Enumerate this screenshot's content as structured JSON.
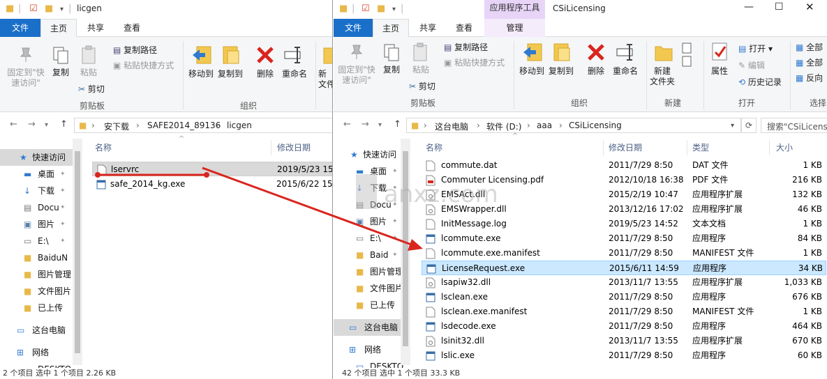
{
  "left": {
    "title": "licgen",
    "tabs": [
      "文件",
      "主页",
      "共享",
      "查看"
    ],
    "ribbon": {
      "pin_label_1": "固定到\"快",
      "pin_label_2": "速访问\"",
      "copy": "复制",
      "paste": "粘贴",
      "copy_path": "复制路径",
      "paste_shortcut": "粘贴快捷方式",
      "cut": "剪切",
      "group_clipboard": "剪贴板",
      "move_to": "移动到",
      "copy_to": "复制到",
      "delete": "删除",
      "rename": "重命名",
      "new_partial_1": "新",
      "new_partial_2": "文件",
      "group_organize": "组织"
    },
    "breadcrumb": [
      "安下载",
      "SAFE2014_89136",
      "licgen"
    ],
    "columns": {
      "name": "名称",
      "date": "修改日期"
    },
    "nav": [
      {
        "label": "快速访问"
      },
      {
        "label": "桌面"
      },
      {
        "label": "下载"
      },
      {
        "label": "Docu"
      },
      {
        "label": "图片"
      },
      {
        "label": "E:\\"
      },
      {
        "label": "BaiduN"
      },
      {
        "label": "图片管理"
      },
      {
        "label": "文件图片"
      },
      {
        "label": "已上传"
      },
      {
        "label": "这台电脑"
      },
      {
        "label": "网络"
      },
      {
        "label": "DESKTO"
      }
    ],
    "files": [
      {
        "name": "lservrc",
        "date": "2019/5/23 15"
      },
      {
        "name": "safe_2014_kg.exe",
        "date": "2015/6/22 15"
      }
    ],
    "status": "2 个项目    选中 1 个项目  2.26 KB"
  },
  "right": {
    "title": "CSiLicensing",
    "context_tab_header": "应用程序工具",
    "tabs": [
      "文件",
      "主页",
      "共享",
      "查看",
      "管理"
    ],
    "ribbon": {
      "pin_label_1": "固定到\"快",
      "pin_label_2": "速访问\"",
      "copy": "复制",
      "paste": "粘贴",
      "copy_path": "复制路径",
      "paste_shortcut": "粘贴快捷方式",
      "cut": "剪切",
      "group_clipboard": "剪贴板",
      "move_to": "移动到",
      "copy_to": "复制到",
      "delete": "删除",
      "rename": "重命名",
      "group_organize": "组织",
      "new_folder_1": "新建",
      "new_folder_2": "文件夹",
      "group_new": "新建",
      "properties": "属性",
      "open": "打开",
      "edit": "编辑",
      "history": "历史记录",
      "group_open": "打开",
      "select_all_1": "全部",
      "select_all_2": "全部",
      "invert": "反向",
      "group_select": "选择"
    },
    "breadcrumb": [
      "这台电脑",
      "软件 (D:)",
      "aaa",
      "CSiLicensing"
    ],
    "search_placeholder": "搜索\"CSiLicensi",
    "columns": {
      "name": "名称",
      "date": "修改日期",
      "type": "类型",
      "size": "大小"
    },
    "nav": [
      {
        "label": "快速访问"
      },
      {
        "label": "桌面"
      },
      {
        "label": "下载"
      },
      {
        "label": "Docu"
      },
      {
        "label": "图片"
      },
      {
        "label": "E:\\"
      },
      {
        "label": "Baid"
      },
      {
        "label": "图片管理"
      },
      {
        "label": "文件图片"
      },
      {
        "label": "已上传"
      },
      {
        "label": "这台电脑"
      },
      {
        "label": "网络"
      },
      {
        "label": "DESKTO"
      }
    ],
    "files": [
      {
        "name": "commute.dat",
        "date": "2011/7/29 8:50",
        "type": "DAT 文件",
        "size": "1 KB"
      },
      {
        "name": "Commuter Licensing.pdf",
        "date": "2012/10/18 16:38",
        "type": "PDF 文件",
        "size": "216 KB"
      },
      {
        "name": "EMSAct.dll",
        "date": "2015/2/19 10:47",
        "type": "应用程序扩展",
        "size": "132 KB"
      },
      {
        "name": "EMSWrapper.dll",
        "date": "2013/12/16 17:02",
        "type": "应用程序扩展",
        "size": "46 KB"
      },
      {
        "name": "InitMessage.log",
        "date": "2019/5/23 14:52",
        "type": "文本文档",
        "size": "1 KB"
      },
      {
        "name": "lcommute.exe",
        "date": "2011/7/29 8:50",
        "type": "应用程序",
        "size": "84 KB"
      },
      {
        "name": "lcommute.exe.manifest",
        "date": "2011/7/29 8:50",
        "type": "MANIFEST 文件",
        "size": "1 KB"
      },
      {
        "name": "LicenseRequest.exe",
        "date": "2015/6/11 14:59",
        "type": "应用程序",
        "size": "34 KB"
      },
      {
        "name": "lsapiw32.dll",
        "date": "2013/11/7 13:55",
        "type": "应用程序扩展",
        "size": "1,033 KB"
      },
      {
        "name": "lsclean.exe",
        "date": "2011/7/29 8:50",
        "type": "应用程序",
        "size": "676 KB"
      },
      {
        "name": "lsclean.exe.manifest",
        "date": "2011/7/29 8:50",
        "type": "MANIFEST 文件",
        "size": "1 KB"
      },
      {
        "name": "lsdecode.exe",
        "date": "2011/7/29 8:50",
        "type": "应用程序",
        "size": "464 KB"
      },
      {
        "name": "lsinit32.dll",
        "date": "2013/11/7 13:55",
        "type": "应用程序扩展",
        "size": "670 KB"
      },
      {
        "name": "lslic.exe",
        "date": "2011/7/29 8:50",
        "type": "应用程序",
        "size": "60 KB"
      }
    ],
    "status": "42 个项目    选中 1 个项目  33.3 KB"
  },
  "watermark_text": "anxz.com",
  "colors": {
    "file_tab": "#1a6fc9",
    "selection": "#cce8ff",
    "arrow": "#d9251d",
    "context_tab": "#e7d4f7"
  }
}
